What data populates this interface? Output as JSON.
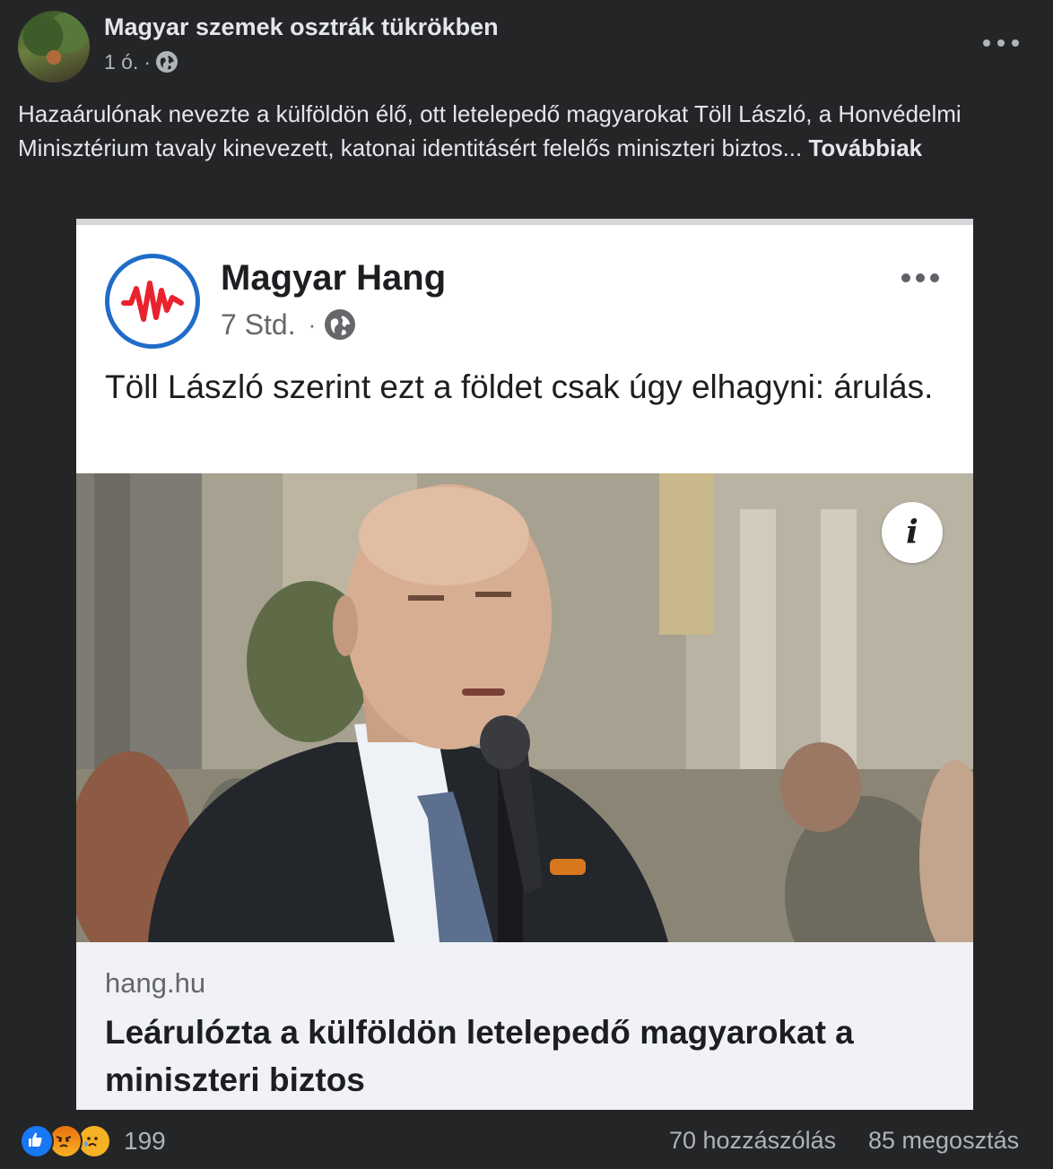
{
  "post": {
    "author": "Magyar szemek osztrák tükrökben",
    "time": "1 ó.",
    "separator": "·",
    "privacy_icon": "globe-icon",
    "text": "Hazaárulónak nevezte a külföldön élő, ott letelepedő magyarokat Töll László, a Honvédelmi Minisztérium tavaly kinevezett, katonai identitásért felelős miniszteri biztos... ",
    "see_more": "Továbbiak",
    "more_icon": "ellipsis-icon"
  },
  "shared": {
    "author": "Magyar Hang",
    "time": "7 Std.",
    "separator": "·",
    "privacy_icon": "globe-icon",
    "text": "Töll László szerint ezt a földet csak úgy elhagyni: árulás.",
    "info_icon": "i",
    "link": {
      "domain": "hang.hu",
      "title": "Leárulózta a külföldön letelepedő magyarokat a miniszteri biztos"
    }
  },
  "footer": {
    "reactions": [
      "like",
      "angry",
      "sad"
    ],
    "reaction_count": "199",
    "comments": "70 hozzászólás",
    "shares": "85 megosztás"
  },
  "colors": {
    "background": "#242526",
    "text_primary": "#e4e6eb",
    "text_secondary": "#b0b3b8",
    "like_blue": "#1877f2",
    "logo_blue": "#1f6cc9",
    "logo_red": "#e8232d"
  }
}
